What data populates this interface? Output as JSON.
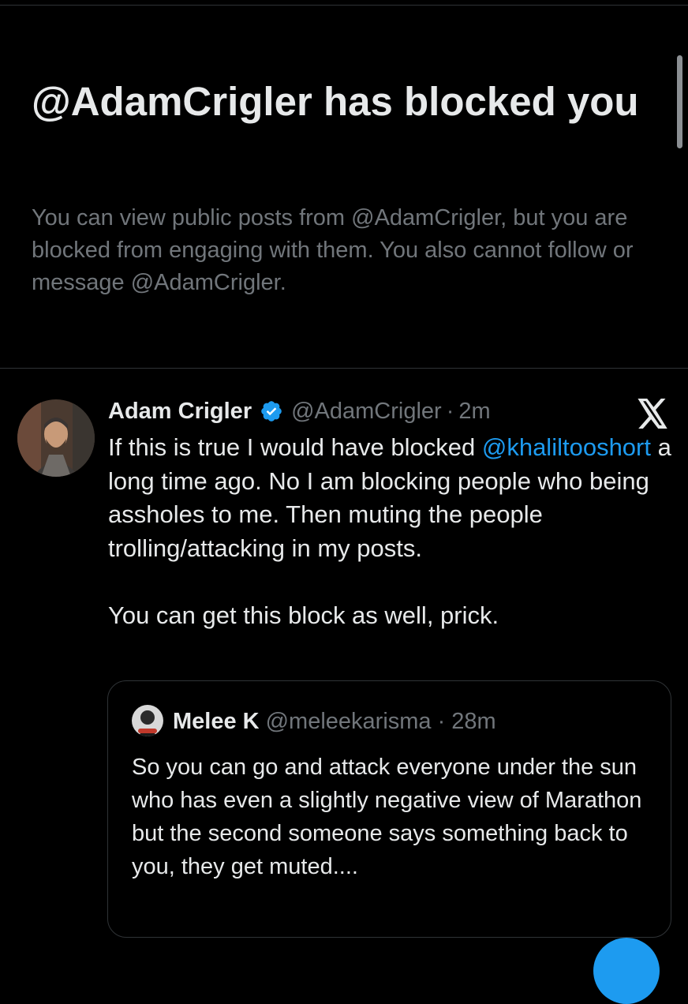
{
  "block_notice": {
    "title": "@AdamCrigler has blocked you",
    "description": "You can view public posts from @AdamCrigler, but you are blocked from engaging with them. You also cannot follow or message @AdamCrigler."
  },
  "post": {
    "author_name": "Adam Crigler",
    "author_handle": "@AdamCrigler",
    "separator": "·",
    "time": "2m",
    "body_before_mention": "If this is true I would have blocked ",
    "mention": "@khaliltooshort",
    "body_after_mention": " a long time ago.  No I am blocking people who being assholes to me. Then muting the people trolling/attacking in my posts.\n\nYou can get this block as well, prick."
  },
  "quote": {
    "author_name": "Melee K",
    "author_handle": "@meleekarisma",
    "separator": "·",
    "time": "28m",
    "body": "So you can go and attack everyone under the sun who has even a slightly negative view of Marathon but the second someone says something back to you, they get muted...."
  },
  "colors": {
    "background": "#000000",
    "text_primary": "#e7e9ea",
    "text_secondary": "#71767b",
    "accent": "#1d9bf0",
    "border": "#2f3336"
  },
  "icons": {
    "verified": "verified-badge-icon",
    "close": "x-logo-icon"
  }
}
